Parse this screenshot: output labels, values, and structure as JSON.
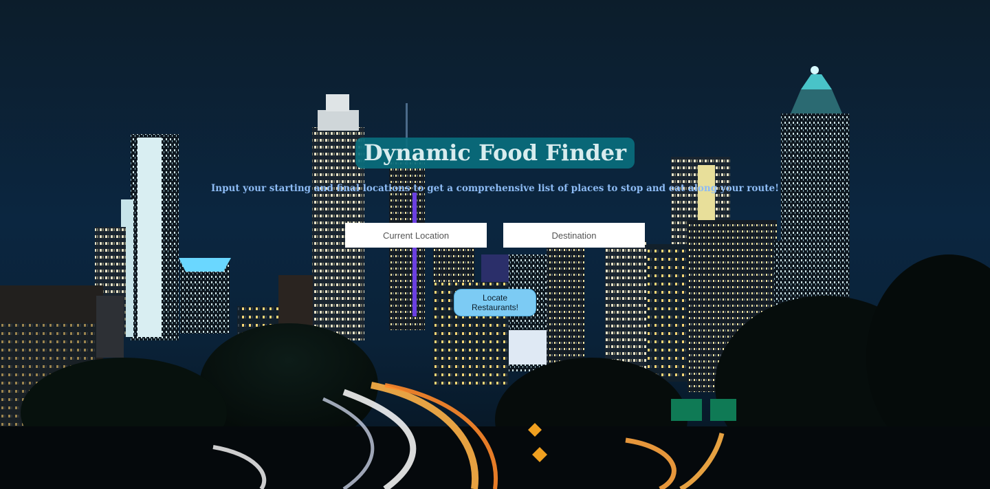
{
  "page": {
    "title": "Dynamic Food Finder",
    "subtitle": "Input your starting and final locations to get a comprehensive list of places to stop and eat along your route!"
  },
  "form": {
    "current_location_placeholder": "Current Location",
    "destination_placeholder": "Destination",
    "submit_label": "Locate Restaurants!"
  },
  "colors": {
    "title_background": "#0a6e7d",
    "subtitle_text": "#8dbbf4",
    "button_background": "#7ccbf4",
    "sky": "#0a1f33"
  },
  "background": {
    "icon": "city-skyline-night-photo"
  }
}
